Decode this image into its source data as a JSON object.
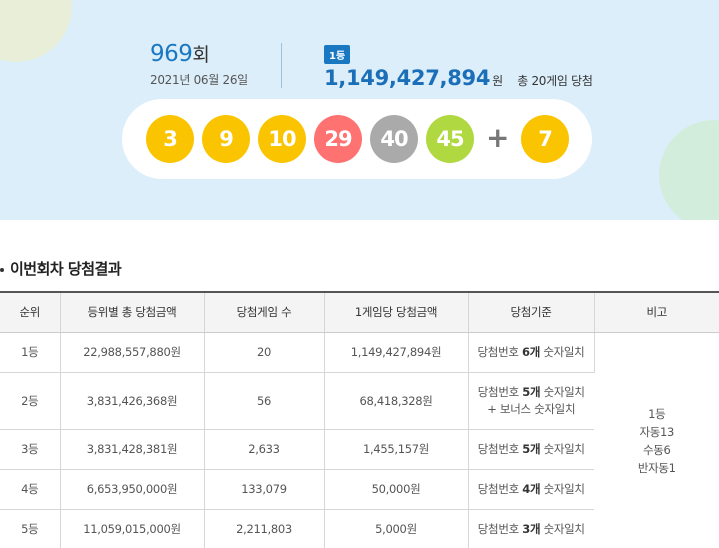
{
  "header": {
    "round_number": "969",
    "round_suffix": "회",
    "draw_date": "2021년 06월 26일",
    "rank_badge": "1등",
    "first_prize_amount": "1,149,427,894",
    "first_prize_unit": "원",
    "first_prize_games": "총 20게임 당첨"
  },
  "winning_numbers": {
    "numbers": [
      {
        "value": "3",
        "color": "#fbc400"
      },
      {
        "value": "9",
        "color": "#fbc400"
      },
      {
        "value": "10",
        "color": "#fbc400"
      },
      {
        "value": "29",
        "color": "#ff7272"
      },
      {
        "value": "40",
        "color": "#aaaaaa"
      },
      {
        "value": "45",
        "color": "#b0d840"
      }
    ],
    "plus_sign": "+",
    "bonus": {
      "value": "7",
      "color": "#fbc400"
    }
  },
  "section": {
    "title": "이번회차 당첨결과"
  },
  "table": {
    "headers": [
      "순위",
      "등위별 총 당첨금액",
      "당첨게임 수",
      "1게임당 당첨금액",
      "당첨기준",
      "비고"
    ],
    "rows": [
      {
        "rank": "1등",
        "total": "22,988,557,880원",
        "games": "20",
        "per_game": "1,149,427,894원",
        "crit_prefix": "당첨번호 ",
        "crit_bold": "6개",
        "crit_suffix": " 숫자일치",
        "crit_line2": ""
      },
      {
        "rank": "2등",
        "total": "3,831,426,368원",
        "games": "56",
        "per_game": "68,418,328원",
        "crit_prefix": "당첨번호 ",
        "crit_bold": "5개",
        "crit_suffix": " 숫자일치",
        "crit_line2": "+ 보너스 숫자일치"
      },
      {
        "rank": "3등",
        "total": "3,831,428,381원",
        "games": "2,633",
        "per_game": "1,455,157원",
        "crit_prefix": "당첨번호 ",
        "crit_bold": "5개",
        "crit_suffix": " 숫자일치",
        "crit_line2": ""
      },
      {
        "rank": "4등",
        "total": "6,653,950,000원",
        "games": "133,079",
        "per_game": "50,000원",
        "crit_prefix": "당첨번호 ",
        "crit_bold": "4개",
        "crit_suffix": " 숫자일치",
        "crit_line2": ""
      },
      {
        "rank": "5등",
        "total": "11,059,015,000원",
        "games": "2,211,803",
        "per_game": "5,000원",
        "crit_prefix": "당첨번호 ",
        "crit_bold": "3개",
        "crit_suffix": " 숫자일치",
        "crit_line2": ""
      }
    ],
    "note_lines": [
      "1등",
      "자동13",
      "수동6",
      "반자동1"
    ]
  }
}
